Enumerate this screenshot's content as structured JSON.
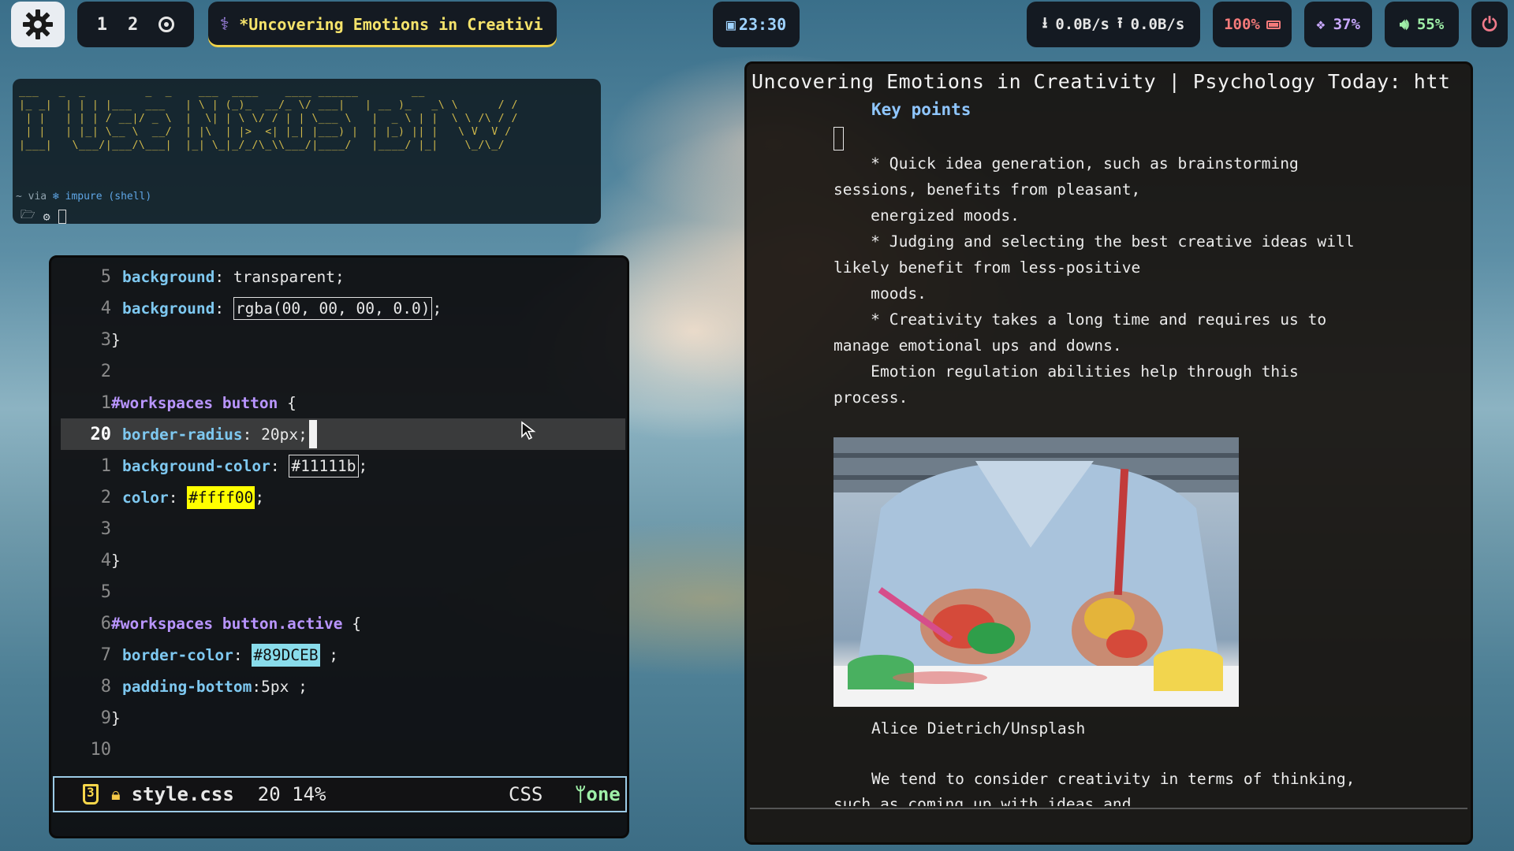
{
  "topbar": {
    "workspaces": [
      "1",
      "2"
    ],
    "window_title": "*Uncovering Emotions in Creativi",
    "clock": "23:30",
    "net_down": "0.0B/s",
    "net_up": "0.0B/s",
    "battery": "100%",
    "cpu": "37%",
    "volume": "55%"
  },
  "terminal": {
    "ascii_art": "___   _  _         _  _    ___  ____    ____ ______        __\n|_ _|  | | | |___  ___   | \\ | (_)_  __/_ \\/ ___|   | __ )_   _\\ \\      / /\n | |   | | | / __|/ _ \\  |  \\| | \\ \\/ / | | \\___ \\   |  _ \\ | |  \\ \\ /\\ / /\n | |   | |_| \\__ \\  __/  | |\\  | |>  <| |_| |___) |  | |_) || |   \\ V  V /\n|___|   \\___/|___/\\___|  |_| \\_|_/_/\\_\\\\___/|____/   |____/ |_|    \\_/\\_/",
    "prompt_prefix": "~ via",
    "prompt_env": "impure (shell)"
  },
  "editor": {
    "lines": [
      {
        "num": "5",
        "prop": "background",
        "value": "transparent;"
      },
      {
        "num": "4",
        "prop": "background",
        "value_boxed": "rgba(00, 00, 00, 0.0)",
        "tail": ";"
      },
      {
        "num": "3",
        "plain": "}"
      },
      {
        "num": "2",
        "plain": ""
      },
      {
        "num": "1",
        "selector": "#workspaces button",
        "tail": " {"
      },
      {
        "num": "20",
        "prop": "border-radius",
        "value": "20px;"
      },
      {
        "num": "1",
        "prop": "background-color",
        "value_boxed": "#11111b",
        "tail": ";"
      },
      {
        "num": "2",
        "prop": "color",
        "value_swatch": "#ffff00",
        "tail": ";"
      },
      {
        "num": "3",
        "plain": ""
      },
      {
        "num": "4",
        "plain": "}"
      },
      {
        "num": "5",
        "plain": ""
      },
      {
        "num": "6",
        "selector": "#workspaces button.active",
        "tail": " {"
      },
      {
        "num": "7",
        "prop": "border-color",
        "value_swatch": "#89DCEB",
        "tail": " ;"
      },
      {
        "num": "8",
        "prop": "padding-bottom",
        "value": "5px ;"
      },
      {
        "num": "9",
        "plain": "}"
      },
      {
        "num": "10",
        "plain": ""
      }
    ],
    "status": {
      "filename": "style.css",
      "position": "20 14%",
      "filetype": "CSS",
      "branch": "one"
    }
  },
  "reader": {
    "title": "Uncovering Emotions in Creativity | Psychology Today: htt",
    "key_points": "Key points",
    "bullets": [
      "    * Quick idea generation, such as brainstorming\nsessions, benefits from pleasant,\n    energized moods.",
      "    * Judging and selecting the best creative ideas will\nlikely benefit from less-positive\n    moods.",
      "    * Creativity takes a long time and requires us to\nmanage emotional ups and downs.\n    Emotion regulation abilities help through this\nprocess."
    ],
    "caption": "Alice Dietrich/Unsplash",
    "body_line1": "We tend to consider creativity in terms of thinking,",
    "body_line2": "such as coming up with ideas and"
  },
  "colors": {
    "accent_yellow": "#f5e36b",
    "swatch_yellow": "#ffff00",
    "swatch_blue": "#89DCEB",
    "selector_purple": "#b995ff",
    "property_blue": "#7ec8f0"
  }
}
